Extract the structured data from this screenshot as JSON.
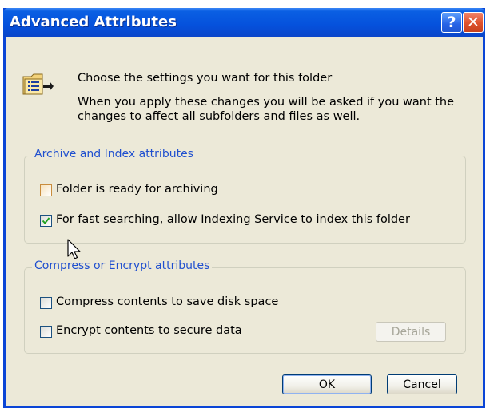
{
  "dialog": {
    "title": "Advanced Attributes",
    "help_button": "?",
    "close_button": "✕"
  },
  "intro": {
    "line1": "Choose the settings you want for this folder",
    "line2": "When you apply these changes you will be asked if you want the",
    "line3": "changes to affect all subfolders and files as well."
  },
  "archive_group": {
    "legend": "Archive and Index attributes",
    "options": [
      {
        "label": "Folder is ready for archiving",
        "checked": false
      },
      {
        "label": "For fast searching, allow Indexing Service to index this folder",
        "checked": true
      }
    ]
  },
  "compress_group": {
    "legend": "Compress or Encrypt attributes",
    "options": [
      {
        "label": "Compress contents to save disk space",
        "checked": false
      },
      {
        "label": "Encrypt contents to secure data",
        "checked": false
      }
    ],
    "details_button": "Details"
  },
  "buttons": {
    "ok": "OK",
    "cancel": "Cancel"
  },
  "colors": {
    "title_bar": "#0551dc",
    "dialog_face": "#ece9d8",
    "group_label": "#1f4fcf",
    "close_button": "#e0532f"
  },
  "icons": {
    "folder": "folder-options-icon",
    "checkmark": "check-icon",
    "pointer": "mouse-cursor-icon"
  }
}
